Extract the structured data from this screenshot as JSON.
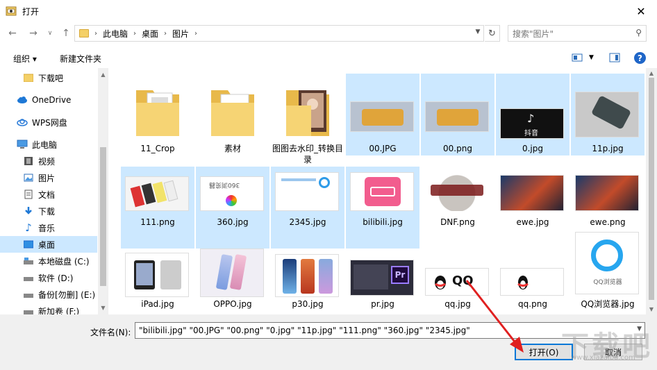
{
  "window": {
    "title": "打开",
    "close_glyph": "✕"
  },
  "nav": {
    "back": "←",
    "forward": "→",
    "dropdown": "∨",
    "up": "↑"
  },
  "address": {
    "crumbs": [
      "此电脑",
      "桌面",
      "图片"
    ],
    "separator": "›"
  },
  "search": {
    "placeholder": "搜索\"图片\""
  },
  "toolbar": {
    "organize": "组织 ▾",
    "new_folder": "新建文件夹",
    "help": "?"
  },
  "sidebar": {
    "items": [
      {
        "label": "下载吧",
        "icon": "folder-icon"
      },
      {
        "label": "OneDrive",
        "icon": "cloud-icon"
      },
      {
        "label": "WPS网盘",
        "icon": "wps-cloud-icon"
      },
      {
        "label": "此电脑",
        "icon": "computer-icon"
      },
      {
        "label": "视频",
        "icon": "video-icon"
      },
      {
        "label": "图片",
        "icon": "pictures-icon"
      },
      {
        "label": "文档",
        "icon": "documents-icon"
      },
      {
        "label": "下载",
        "icon": "download-icon"
      },
      {
        "label": "音乐",
        "icon": "music-icon"
      },
      {
        "label": "桌面",
        "icon": "desktop-icon"
      },
      {
        "label": "本地磁盘 (C:)",
        "icon": "drive-icon"
      },
      {
        "label": "软件 (D:)",
        "icon": "drive-icon"
      },
      {
        "label": "备份[勿删] (E:)",
        "icon": "drive-icon"
      },
      {
        "label": "新加卷 (F:)",
        "icon": "drive-icon"
      }
    ],
    "selected": "桌面"
  },
  "files": [
    {
      "name": "11_Crop",
      "kind": "folder",
      "selected": false
    },
    {
      "name": "素材",
      "kind": "folder",
      "selected": false
    },
    {
      "name": "图图去水印_转换目录",
      "kind": "folder",
      "selected": false
    },
    {
      "name": "00.JPG",
      "kind": "image",
      "selected": true
    },
    {
      "name": "00.png",
      "kind": "image",
      "selected": true
    },
    {
      "name": "0.jpg",
      "kind": "image",
      "selected": true,
      "caption": "抖音"
    },
    {
      "name": "11p.jpg",
      "kind": "image",
      "selected": true
    },
    {
      "name": "111.png",
      "kind": "image",
      "selected": true
    },
    {
      "name": "360.jpg",
      "kind": "image",
      "selected": true,
      "caption": "360浏览器"
    },
    {
      "name": "2345.jpg",
      "kind": "image",
      "selected": true
    },
    {
      "name": "bilibili.jpg",
      "kind": "image",
      "selected": true
    },
    {
      "name": "DNF.png",
      "kind": "image",
      "selected": false
    },
    {
      "name": "ewe.jpg",
      "kind": "image",
      "selected": false
    },
    {
      "name": "ewe.png",
      "kind": "image",
      "selected": false
    },
    {
      "name": "iPad.jpg",
      "kind": "image",
      "selected": false
    },
    {
      "name": "OPPO.jpg",
      "kind": "image",
      "selected": false
    },
    {
      "name": "p30.jpg",
      "kind": "image",
      "selected": false
    },
    {
      "name": "pr.jpg",
      "kind": "image",
      "selected": false
    },
    {
      "name": "qq.jpg",
      "kind": "image",
      "selected": false,
      "caption": "QQ"
    },
    {
      "name": "qq.png",
      "kind": "image",
      "selected": false
    },
    {
      "name": "QQ浏览器.jpg",
      "kind": "image",
      "selected": false,
      "caption": "QQ浏览器"
    }
  ],
  "footer": {
    "filename_label": "文件名(N):",
    "filename_value": "\"bilibili.jpg\" \"00.JPG\" \"00.png\" \"0.jpg\" \"11p.jpg\" \"111.png\" \"360.jpg\" \"2345.jpg\"",
    "open": "打开(O)",
    "cancel": "取消"
  },
  "watermark": {
    "text": "下载吧",
    "url": "www.xiazaiba.com"
  },
  "colors": {
    "selection": "#cce8ff",
    "accent": "#0078d7",
    "arrow": "#e02020"
  }
}
